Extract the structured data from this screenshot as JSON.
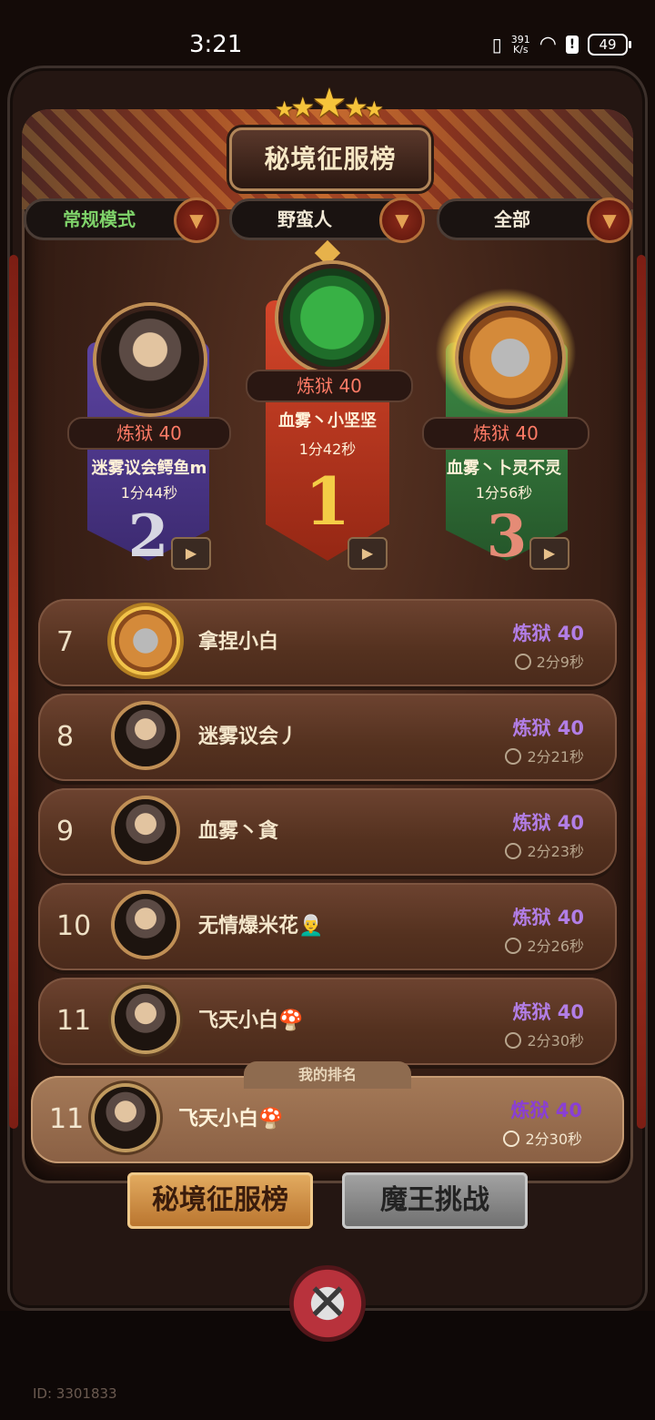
{
  "status_bar": {
    "time": "3:21",
    "speed_value": "391",
    "speed_unit": "K/s",
    "battery": "49",
    "icons": [
      "vibrate-icon",
      "wifi-icon",
      "alert-icon",
      "battery-icon"
    ]
  },
  "header": {
    "title": "秘境征服榜",
    "stars": 5
  },
  "filters": [
    {
      "label": "常规模式"
    },
    {
      "label": "野蛮人"
    },
    {
      "label": "全部"
    }
  ],
  "podium": [
    {
      "rank": "1",
      "difficulty": "炼狱 40",
      "name": "血雾丶小坚坚",
      "time": "1分42秒",
      "color": "#b4311d"
    },
    {
      "rank": "2",
      "difficulty": "炼狱 40",
      "name": "迷雾议会鳄鱼m",
      "time": "1分44秒",
      "color": "#4b3480"
    },
    {
      "rank": "3",
      "difficulty": "炼狱 40",
      "name": "血雾丶卜灵不灵",
      "time": "1分56秒",
      "color": "#2f6a35"
    }
  ],
  "rows": [
    {
      "rank": "7",
      "name": "拿捏小白",
      "difficulty": "炼狱 40",
      "time": "2分9秒"
    },
    {
      "rank": "8",
      "name": "迷雾议会丿",
      "difficulty": "炼狱 40",
      "time": "2分21秒"
    },
    {
      "rank": "9",
      "name": "血雾丶貪",
      "difficulty": "炼狱 40",
      "time": "2分23秒"
    },
    {
      "rank": "10",
      "name": "无情爆米花👨‍🦳",
      "difficulty": "炼狱 40",
      "time": "2分26秒"
    },
    {
      "rank": "11",
      "name": "飞天小白🍄",
      "difficulty": "炼狱 40",
      "time": "2分30秒"
    }
  ],
  "my_rank": {
    "tag": "我的排名",
    "rank": "11",
    "name": "飞天小白🍄",
    "difficulty": "炼狱 40",
    "time": "2分30秒"
  },
  "tabs": [
    {
      "label": "秘境征服榜"
    },
    {
      "label": "魔王挑战"
    }
  ],
  "footer": {
    "user_id": "ID: 3301833"
  }
}
